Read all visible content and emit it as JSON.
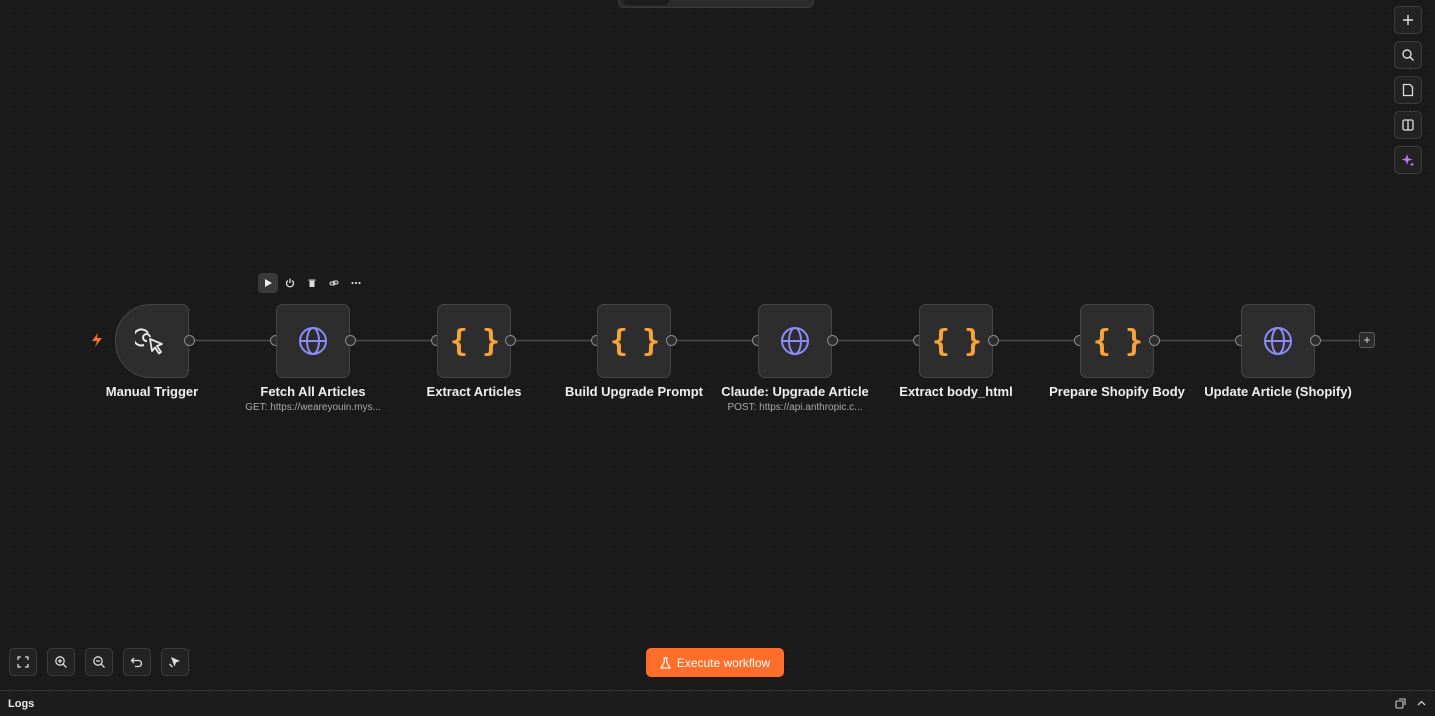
{
  "workflow": {
    "nodes": [
      {
        "id": "manual-trigger",
        "label": "Manual Trigger",
        "subtitle": "",
        "icon": "cursor-click-icon"
      },
      {
        "id": "fetch-all-articles",
        "label": "Fetch All Articles",
        "subtitle": "GET: https://weareyouin.mys...",
        "icon": "globe-icon"
      },
      {
        "id": "extract-articles",
        "label": "Extract Articles",
        "subtitle": "",
        "icon": "code-braces-icon"
      },
      {
        "id": "build-upgrade-prompt",
        "label": "Build Upgrade Prompt",
        "subtitle": "",
        "icon": "code-braces-icon"
      },
      {
        "id": "claude-upgrade-article",
        "label": "Claude: Upgrade Article",
        "subtitle": "POST: https://api.anthropic.c...",
        "icon": "globe-icon"
      },
      {
        "id": "extract-body-html",
        "label": "Extract body_html",
        "subtitle": "",
        "icon": "code-braces-icon"
      },
      {
        "id": "prepare-shopify-body",
        "label": "Prepare Shopify Body",
        "subtitle": "",
        "icon": "code-braces-icon"
      },
      {
        "id": "update-article-shopify",
        "label": "Update Article (Shopify)",
        "subtitle": "",
        "icon": "globe-icon"
      }
    ],
    "braces_glyph": "{ }"
  },
  "node_toolbar": {
    "items": [
      "play-icon",
      "power-icon",
      "trash-icon",
      "link-icon",
      "more-icon"
    ]
  },
  "right_tools": [
    "plus-icon",
    "search-icon",
    "sticky-note-icon",
    "panel-icon",
    "sparkle-icon"
  ],
  "bottom_tools": [
    "fit-view-icon",
    "zoom-in-icon",
    "zoom-out-icon",
    "undo-icon",
    "tidy-up-icon"
  ],
  "execute_button": {
    "label": "Execute workflow",
    "icon": "flask-icon"
  },
  "logs": {
    "title": "Logs"
  },
  "add_node_label": "+",
  "colors": {
    "accent": "#ff6d2a",
    "globe": "#8c8cf8",
    "braces": "#f6a43a",
    "trigger": "#ff6d2a"
  }
}
